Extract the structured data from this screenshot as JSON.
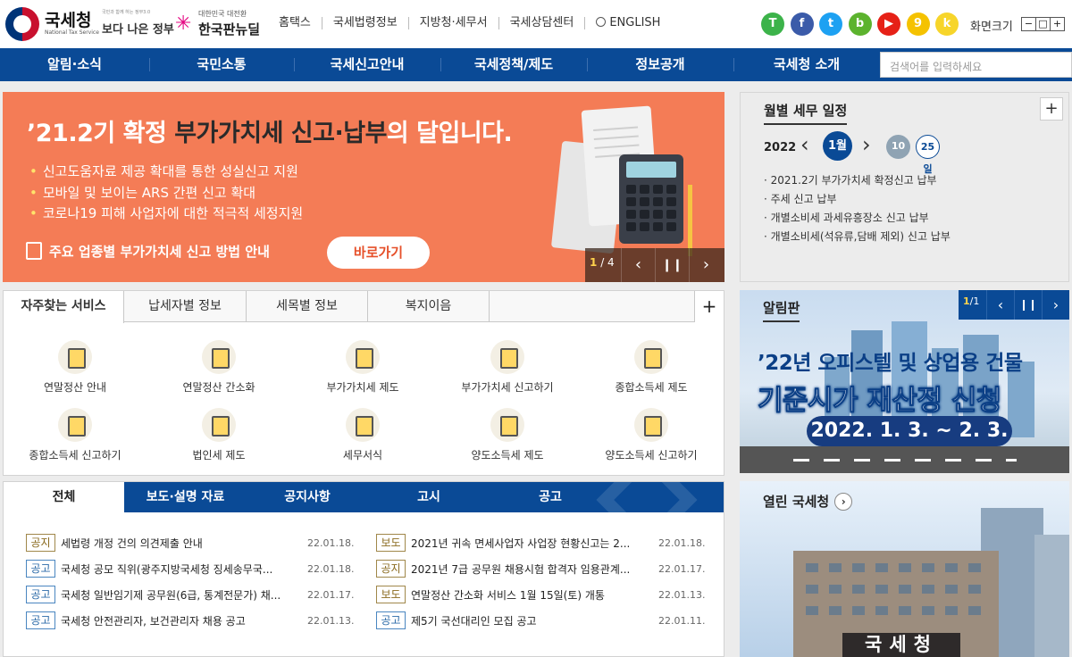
{
  "header": {
    "logo_text": "국세청",
    "logo_sub": "National Tax Service",
    "slogan_small": "국민과 함께 하는 정부3.0",
    "slogan_main": "보다 나은 정부",
    "newdeal_small": "대한민국 대전환",
    "newdeal_main": "한국판뉴딜",
    "links": [
      "홈택스",
      "국세법령정보",
      "지방청·세무서",
      "국세상담센터",
      "ENGLISH"
    ],
    "social": [
      {
        "icon": "talk-icon",
        "glyph": "T",
        "color": "#3cb34a"
      },
      {
        "icon": "facebook-icon",
        "glyph": "f",
        "color": "#3b5ba9"
      },
      {
        "icon": "twitter-icon",
        "glyph": "t",
        "color": "#1da1f2"
      },
      {
        "icon": "blog-icon",
        "glyph": "b",
        "color": "#5cb32e"
      },
      {
        "icon": "youtube-icon",
        "glyph": "▶",
        "color": "#e62117"
      },
      {
        "icon": "post-icon",
        "glyph": "9",
        "color": "#f5c200"
      },
      {
        "icon": "kakaostory-icon",
        "glyph": "k",
        "color": "#f7d52a"
      }
    ],
    "font_size_label": "화면크기",
    "font_buttons": [
      "−",
      "□",
      "+"
    ]
  },
  "gnb": {
    "items": [
      "알림·소식",
      "국민소통",
      "국세신고안내",
      "국세정책/제도",
      "정보공개",
      "국세청 소개"
    ],
    "search_placeholder": "검색어를 입력하세요"
  },
  "banner": {
    "title_prefix": "’21.2기 확정 ",
    "title_highlight": "부가가치세 신고·납부",
    "title_suffix": "의 달입니다.",
    "bullets": [
      "신고도움자료 제공 확대를 통한 성실신고 지원",
      "모바일 및 보이는 ARS 간편 신고 확대",
      "코로나19 피해 사업자에 대한 적극적 세정지원"
    ],
    "guide_text": "주요 업종별 부가가치세 신고 방법 안내",
    "button_label": "바로가기",
    "counter_current": "1",
    "counter_total": "/ 4"
  },
  "schedule": {
    "title": "월별 세무 일정",
    "year": "2022",
    "month": "1월",
    "days": [
      "10",
      "25일"
    ],
    "items": [
      "· 2021.2기 부가가치세 확정신고 납부",
      "· 주세 신고 납부",
      "· 개별소비세 과세유흥장소 신고 납부",
      "· 개별소비세(석유류,담배 제외) 신고 납부"
    ]
  },
  "services": {
    "tabs": [
      "자주찾는 서비스",
      "납세자별 정보",
      "세목별 정보",
      "복지이음"
    ],
    "row1": [
      "연말정산 안내",
      "연말정산 간소화",
      "부가가치세 제도",
      "부가가치세 신고하기",
      "종합소득세 제도"
    ],
    "row2": [
      "종합소득세 신고하기",
      "법인세 제도",
      "세무서식",
      "양도소득세 제도",
      "양도소득세 신고하기"
    ]
  },
  "notice": {
    "tabs": [
      "전체",
      "보도·설명 자료",
      "공지사항",
      "고시",
      "공고"
    ],
    "left": [
      {
        "tag": "공지",
        "type": "t1",
        "text": "세법령 개정 건의 의견제출 안내",
        "date": "22.01.18."
      },
      {
        "tag": "공고",
        "type": "t2",
        "text": "국세청 공모 직위(광주지방국세청 징세송무국...",
        "date": "22.01.18."
      },
      {
        "tag": "공고",
        "type": "t2",
        "text": "국세청 일반임기제 공무원(6급, 통계전문가) 채...",
        "date": "22.01.17."
      },
      {
        "tag": "공고",
        "type": "t2",
        "text": "국세청 안전관리자, 보건관리자 채용 공고",
        "date": "22.01.13."
      }
    ],
    "right": [
      {
        "tag": "보도",
        "type": "t1",
        "text": "2021년 귀속 면세사업자 사업장 현황신고는 2...",
        "date": "22.01.18."
      },
      {
        "tag": "공지",
        "type": "t1",
        "text": "2021년 7급 공무원 채용시험 합격자 임용관계...",
        "date": "22.01.17."
      },
      {
        "tag": "보도",
        "type": "t1",
        "text": "연말정산 간소화 서비스 1월 15일(토) 개통",
        "date": "22.01.13."
      },
      {
        "tag": "공고",
        "type": "t2",
        "text": "제5기 국선대리인 모집 공고",
        "date": "22.01.11."
      }
    ]
  },
  "board": {
    "title": "알림판",
    "counter_current": "1",
    "counter_total": "/1",
    "line1": "’22년 오피스텔 및 상업용 건물",
    "line2": "기준시가 재산정 신청",
    "line3": "2022. 1. 3. ~ 2. 3."
  },
  "open": {
    "title": "열린 국세청",
    "sign": "국세청"
  }
}
